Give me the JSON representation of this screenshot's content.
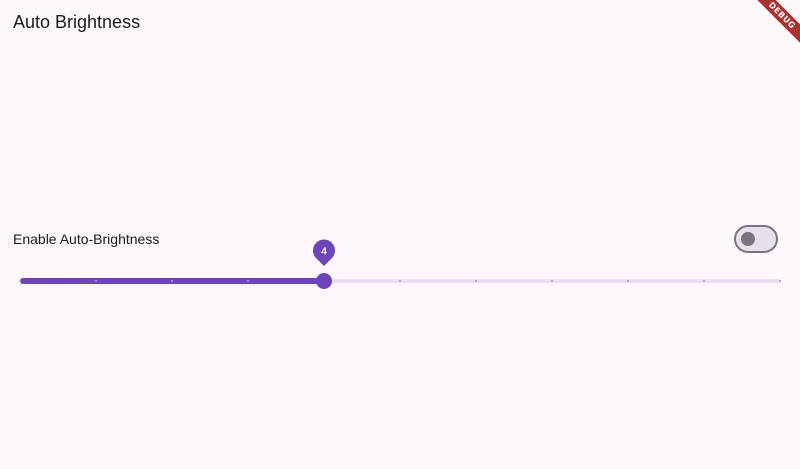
{
  "app_bar": {
    "title": "Auto Brightness"
  },
  "debug_banner": {
    "label": "DEBUG"
  },
  "auto_brightness": {
    "label": "Enable Auto-Brightness",
    "enabled": false
  },
  "brightness_slider": {
    "min": 0,
    "max": 10,
    "divisions": 10,
    "value": 4,
    "value_label": "4"
  },
  "colors": {
    "background": "#fdf7fc",
    "primary": "#6e45b9",
    "inactive_track": "#e8def0",
    "switch_outline": "#79747e",
    "debug_ribbon": "#a8332f"
  }
}
